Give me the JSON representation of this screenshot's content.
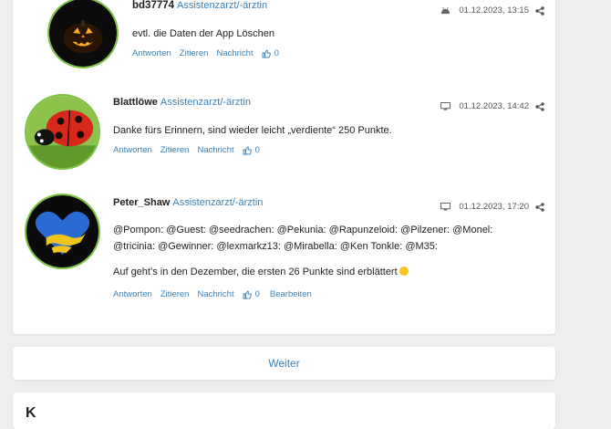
{
  "posts": [
    {
      "author": "bd37774",
      "role": "Assistenzarzt/-ärztin",
      "device": "android-icon",
      "datetime": "01.12.2023, 13:15",
      "lines": [
        "evtl. die Daten der App Löschen"
      ],
      "actions": {
        "reply": "Antworten",
        "quote": "Zitieren",
        "message": "Nachricht",
        "likes": "0"
      }
    },
    {
      "author": "Blattlöwe",
      "role": "Assistenzarzt/-ärztin",
      "device": "desktop-icon",
      "datetime": "01.12.2023, 14:42",
      "lines": [
        "Danke fürs Erinnern, sind wieder leicht „verdiente“ 250 Punkte."
      ],
      "actions": {
        "reply": "Antworten",
        "quote": "Zitieren",
        "message": "Nachricht",
        "likes": "0"
      }
    },
    {
      "author": "Peter_Shaw",
      "role": "Assistenzarzt/-ärztin",
      "device": "desktop-icon",
      "datetime": "01.12.2023, 17:20",
      "lines": [
        "@Pompon: @Guest: @seedrachen: @Pekunia: @Rapunzeloid: @Pilzener: @Monel:",
        "@tricinia: @Gewinner: @lexmarkz13: @Mirabella: @Ken Tonkle: @M35:",
        "Auf geht’s in den Dezember, die ersten 26 Punkte sind erblättert"
      ],
      "actions": {
        "reply": "Antworten",
        "quote": "Zitieren",
        "message": "Nachricht",
        "likes": "0",
        "edit": "Bearbeiten"
      }
    }
  ],
  "pagination": {
    "next_label": "Weiter"
  },
  "next_section": {
    "title": "K"
  },
  "colors": {
    "link": "#3b82b8",
    "avatar_border": "#7cc243",
    "background": "#eceeef"
  }
}
